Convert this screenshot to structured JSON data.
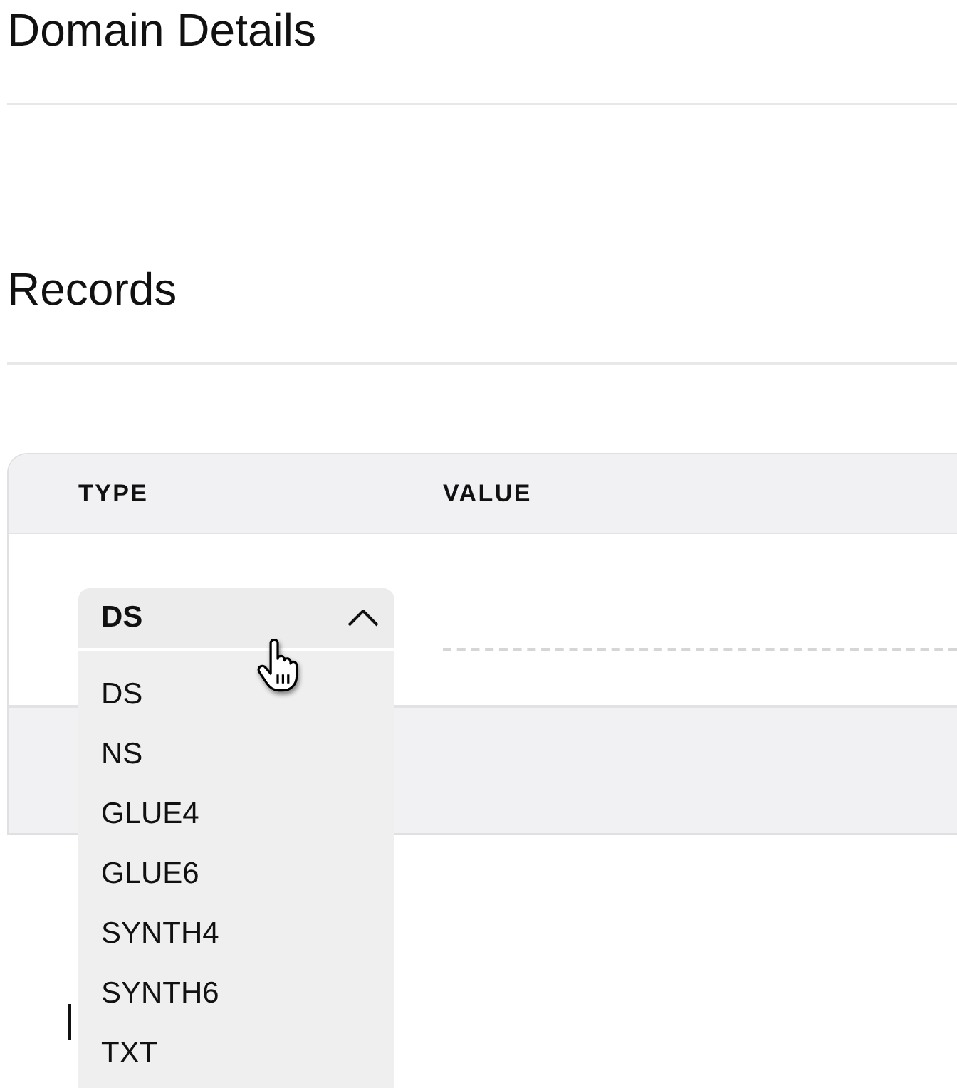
{
  "sections": [
    {
      "title": "Domain Details"
    },
    {
      "title": "Records"
    }
  ],
  "records_table": {
    "columns": [
      "TYPE",
      "VALUE"
    ],
    "rows": [
      {
        "type_select": {
          "value": "DS",
          "expanded": true,
          "options": [
            "DS",
            "NS",
            "GLUE4",
            "GLUE6",
            "SYNTH4",
            "SYNTH6",
            "TXT"
          ]
        }
      }
    ]
  }
}
